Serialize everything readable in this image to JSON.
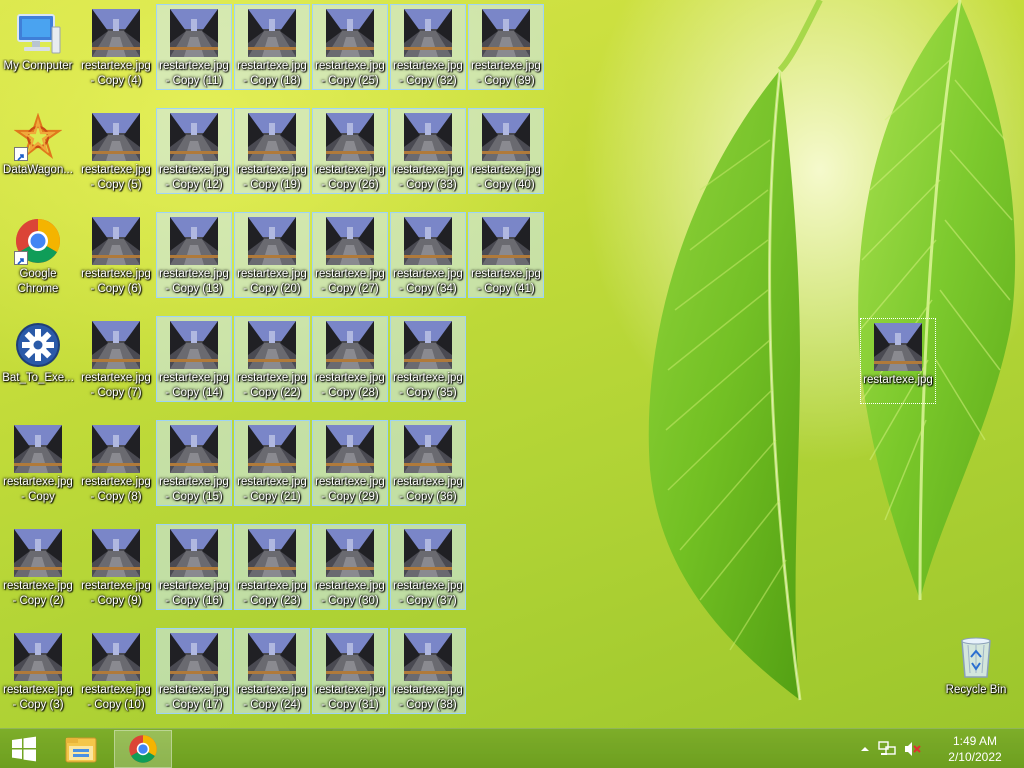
{
  "desktop": {
    "icons": {
      "my_computer": "My Computer",
      "datawagon": "DataWagon...",
      "chrome": "Google Chrome",
      "bat_to_exe": "Bat_To_Exe...",
      "recycle_bin": "Recycle Bin",
      "restart_original": "restartexe.jpg",
      "copy": "restartexe.jpg - Copy",
      "copy_2": "restartexe.jpg - Copy (2)",
      "copy_3": "restartexe.jpg - Copy (3)",
      "copy_4": "restartexe.jpg - Copy (4)",
      "copy_5": "restartexe.jpg - Copy (5)",
      "copy_6": "restartexe.jpg - Copy (6)",
      "copy_7": "restartexe.jpg - Copy (7)",
      "copy_8": "restartexe.jpg - Copy (8)",
      "copy_9": "restartexe.jpg - Copy (9)",
      "copy_10": "restartexe.jpg - Copy (10)",
      "copy_11": "restartexe.jpg - Copy (11)",
      "copy_12": "restartexe.jpg - Copy (12)",
      "copy_13": "restartexe.jpg - Copy (13)",
      "copy_14": "restartexe.jpg - Copy (14)",
      "copy_15": "restartexe.jpg - Copy (15)",
      "copy_16": "restartexe.jpg - Copy (16)",
      "copy_17": "restartexe.jpg - Copy (17)",
      "copy_18": "restartexe.jpg - Copy (18)",
      "copy_19": "restartexe.jpg - Copy (19)",
      "copy_20": "restartexe.jpg - Copy (20)",
      "copy_21": "restartexe.jpg - Copy (21)",
      "copy_22": "restartexe.jpg - Copy (22)",
      "copy_23": "restartexe.jpg - Copy (23)",
      "copy_24": "restartexe.jpg - Copy (24)",
      "copy_25": "restartexe.jpg - Copy (25)",
      "copy_26": "restartexe.jpg - Copy (26)",
      "copy_27": "restartexe.jpg - Copy (27)",
      "copy_28": "restartexe.jpg - Copy (28)",
      "copy_29": "restartexe.jpg - Copy (29)",
      "copy_30": "restartexe.jpg - Copy (30)",
      "copy_31": "restartexe.jpg - Copy (31)",
      "copy_32": "restartexe.jpg - Copy (32)",
      "copy_33": "restartexe.jpg - Copy (33)",
      "copy_34": "restartexe.jpg - Copy (34)",
      "copy_35": "restartexe.jpg - Copy (35)",
      "copy_36": "restartexe.jpg - Copy (36)",
      "copy_37": "restartexe.jpg - Copy (37)",
      "copy_38": "restartexe.jpg - Copy (38)",
      "copy_39": "restartexe.jpg - Copy (39)",
      "copy_40": "restartexe.jpg - Copy (40)",
      "copy_41": "restartexe.jpg - Copy (41)"
    }
  },
  "taskbar": {
    "clock_time": "1:49 AM",
    "clock_date": "2/10/2022",
    "icons": [
      "windows-logo-icon",
      "file-explorer-icon",
      "chrome-icon"
    ],
    "tray_icons": [
      "chevron-up-icon",
      "network-icon",
      "volume-muted-icon"
    ]
  },
  "colors": {
    "selection_fill": "#cde8ff",
    "selection_border": "#99d1ff",
    "taskbar": "#78aa28"
  }
}
